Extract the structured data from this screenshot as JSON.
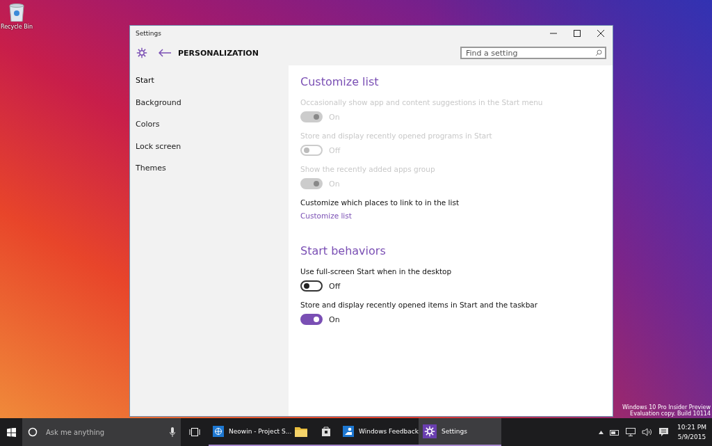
{
  "desktop": {
    "icons": [
      {
        "label": "Recycle Bin"
      }
    ],
    "watermark_lines": [
      "Windows 10 Pro Insider Preview",
      "Evaluation copy. Build 10114"
    ]
  },
  "window": {
    "title": "Settings",
    "section": "PERSONALIZATION",
    "search": {
      "placeholder": "Find a setting"
    }
  },
  "sidebar": {
    "items": [
      {
        "label": "Start",
        "selected": true
      },
      {
        "label": "Background",
        "selected": false
      },
      {
        "label": "Colors",
        "selected": false
      },
      {
        "label": "Lock screen",
        "selected": false
      },
      {
        "label": "Themes",
        "selected": false
      }
    ]
  },
  "sections": [
    {
      "heading": "Customize list",
      "settings": [
        {
          "kind": "toggle",
          "label": "Occasionally show app and content suggestions in the Start menu",
          "on": true,
          "disabled": true,
          "state_text": "On"
        },
        {
          "kind": "toggle",
          "label": "Store and display recently opened programs in Start",
          "on": false,
          "disabled": true,
          "state_text": "Off"
        },
        {
          "kind": "toggle",
          "label": "Show the recently added apps group",
          "on": true,
          "disabled": true,
          "state_text": "On"
        },
        {
          "kind": "link",
          "label": "Customize which places to link to in the list",
          "link": "Customize list"
        }
      ]
    },
    {
      "heading": "Start behaviors",
      "settings": [
        {
          "kind": "toggle",
          "label": "Use full-screen Start when in the desktop",
          "on": false,
          "disabled": false,
          "state_text": "Off"
        },
        {
          "kind": "toggle",
          "label": "Store and display recently opened items in Start and the taskbar",
          "on": true,
          "disabled": false,
          "state_text": "On"
        }
      ]
    }
  ],
  "taskbar": {
    "search": {
      "placeholder": "Ask me anything"
    },
    "apps": [
      {
        "kind": "labeled",
        "label": "Neowin - Project S...",
        "selected": false
      },
      {
        "kind": "icon",
        "selected": false
      },
      {
        "kind": "icon",
        "selected": false
      },
      {
        "kind": "labeled",
        "label": "Windows Feedback",
        "selected": false
      },
      {
        "kind": "labeled",
        "label": "Settings",
        "selected": true
      }
    ],
    "clock": {
      "time": "10:21 PM",
      "date": "5/9/2015"
    }
  }
}
